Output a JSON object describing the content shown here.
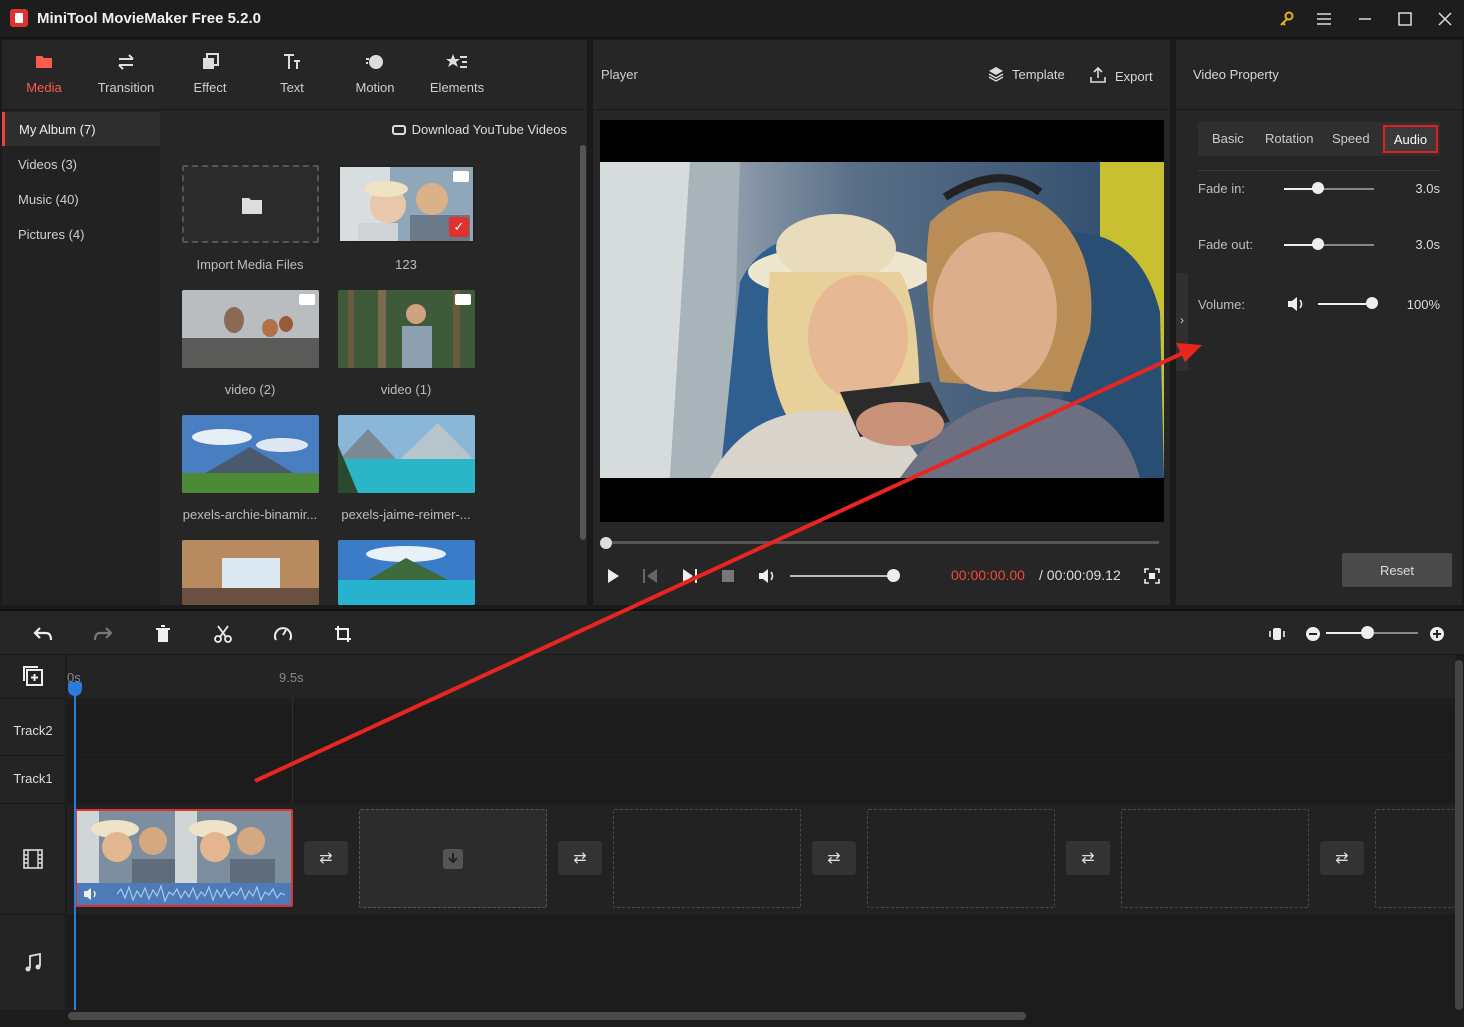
{
  "window": {
    "title": "MiniTool MovieMaker Free 5.2.0",
    "buttons": [
      "key-icon",
      "menu-icon",
      "minimize-icon",
      "maximize-icon",
      "close-icon"
    ]
  },
  "media_tabs": [
    {
      "label": "Media",
      "icon": "folder-icon",
      "active": true
    },
    {
      "label": "Transition",
      "icon": "swap-icon"
    },
    {
      "label": "Effect",
      "icon": "effect-icon"
    },
    {
      "label": "Text",
      "icon": "text-icon"
    },
    {
      "label": "Motion",
      "icon": "motion-icon"
    },
    {
      "label": "Elements",
      "icon": "elements-icon"
    }
  ],
  "album": {
    "items": [
      "My Album (7)",
      "Videos (3)",
      "Music (40)",
      "Pictures (4)"
    ],
    "active_index": 0,
    "download_link": "Download YouTube Videos"
  },
  "media_items": [
    {
      "label": "Import Media Files"
    },
    {
      "label": "123"
    },
    {
      "label": "video (2)"
    },
    {
      "label": "video (1)"
    },
    {
      "label": "pexels-archie-binamir..."
    },
    {
      "label": "pexels-jaime-reimer-..."
    }
  ],
  "player": {
    "title": "Player",
    "template_label": "Template",
    "export_label": "Export",
    "time_current": "00:00:00.00",
    "time_total": "/ 00:00:09.12"
  },
  "property": {
    "title": "Video Property",
    "tabs": [
      "Basic",
      "Rotation",
      "Speed",
      "Audio"
    ],
    "active_tab": "Audio",
    "fade_in_label": "Fade in:",
    "fade_in_value": "3.0s",
    "fade_out_label": "Fade out:",
    "fade_out_value": "3.0s",
    "volume_label": "Volume:",
    "volume_value": "100%",
    "reset_label": "Reset"
  },
  "timeline": {
    "ruler_start": "0s",
    "ruler_mark": "9.5s",
    "tracks": [
      "Track2",
      "Track1"
    ]
  },
  "colors": {
    "accent": "#e8463a",
    "time_red": "#f04a3c",
    "playhead": "#2b7bdc"
  }
}
